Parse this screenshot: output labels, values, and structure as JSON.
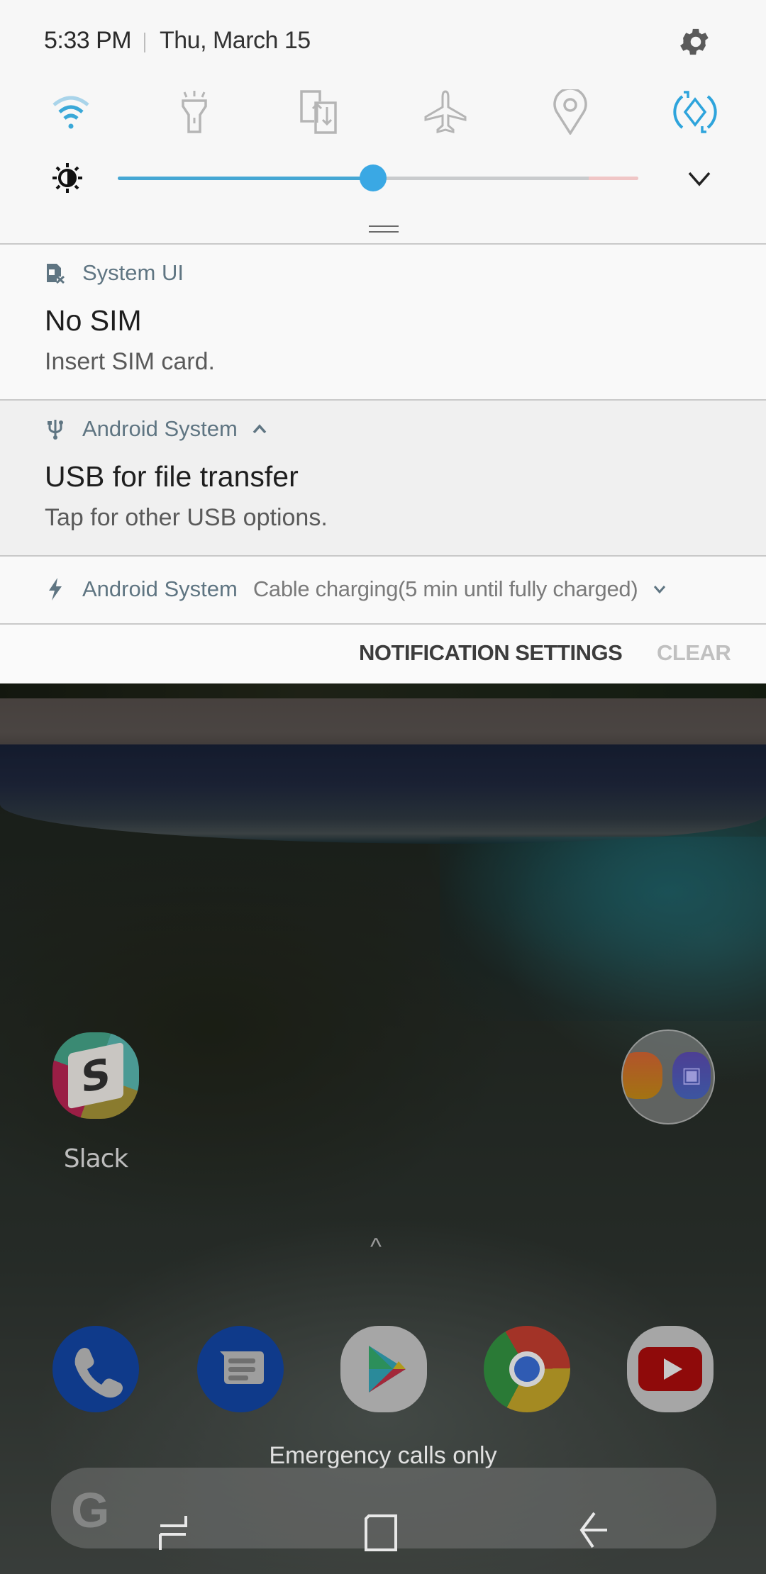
{
  "status": {
    "time": "5:33 PM",
    "date": "Thu, March 15"
  },
  "quick_settings": {
    "tiles": [
      {
        "name": "wifi",
        "icon": "wifi-icon",
        "active": true
      },
      {
        "name": "flashlight",
        "icon": "flashlight-icon",
        "active": false
      },
      {
        "name": "smart-switch",
        "icon": "transfer-icon",
        "active": false
      },
      {
        "name": "airplane-mode",
        "icon": "airplane-icon",
        "active": false
      },
      {
        "name": "location",
        "icon": "location-pin-icon",
        "active": false
      },
      {
        "name": "auto-rotate",
        "icon": "auto-rotate-icon",
        "active": true
      }
    ],
    "brightness_percent": 49,
    "accent_color": "#3aa8e4",
    "inactive_color": "#b5b5b5"
  },
  "notifications": [
    {
      "app": "System UI",
      "icon": "no-sim-icon",
      "title": "No SIM",
      "text": "Insert SIM card."
    },
    {
      "app": "Android System",
      "icon": "usb-icon",
      "expanded": true,
      "title": "USB for file transfer",
      "text": "Tap for other USB options."
    },
    {
      "app": "Android System",
      "icon": "charging-bolt-icon",
      "expanded": false,
      "summary": "Cable charging(5 min until fully charged)"
    }
  ],
  "footer": {
    "settings_label": "NOTIFICATION SETTINGS",
    "clear_label": "CLEAR"
  },
  "home": {
    "apps": [
      {
        "label": "Slack"
      }
    ],
    "folder": {
      "apps": [
        "Gallery",
        "Camera"
      ]
    },
    "dock": [
      "Phone",
      "Messages",
      "Play Store",
      "Chrome",
      "YouTube"
    ],
    "carrier_text": "Emergency calls only",
    "search_logo": "G"
  }
}
